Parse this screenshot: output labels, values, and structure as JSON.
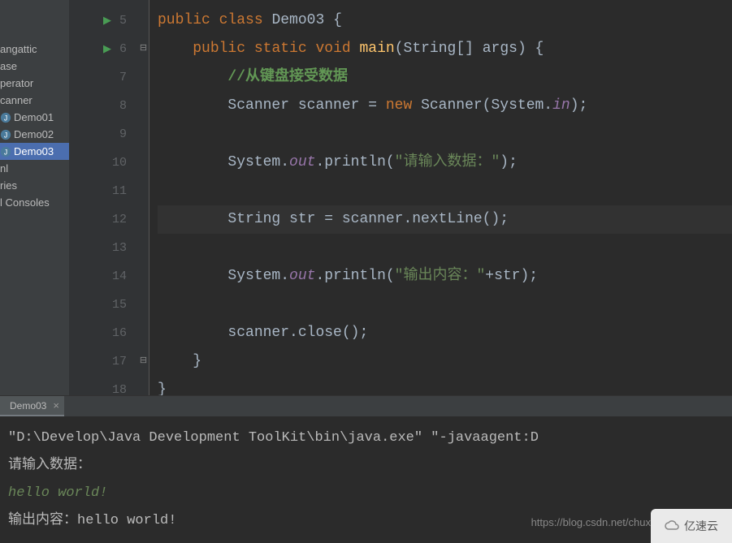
{
  "sidebar": {
    "items": [
      {
        "label": "angattic"
      },
      {
        "label": "ase"
      },
      {
        "label": "perator"
      },
      {
        "label": "canner"
      },
      {
        "label": "Demo01",
        "icon": true
      },
      {
        "label": "Demo02",
        "icon": true
      },
      {
        "label": "Demo03",
        "icon": true,
        "selected": true
      },
      {
        "label": "nl"
      },
      {
        "label": "ries"
      },
      {
        "label": "l Consoles"
      }
    ]
  },
  "editor": {
    "line_start": 5,
    "line_end": 18,
    "highlighted_line": 12,
    "code": {
      "l5": {
        "kw1": "public",
        "kw2": "class",
        "name": "Demo03",
        "brace": "{"
      },
      "l6": {
        "kw1": "public",
        "kw2": "static",
        "kw3": "void",
        "fn": "main",
        "params": "(String[] args) {"
      },
      "l7": {
        "cmt": "//从键盘接受数据"
      },
      "l8": {
        "t1": "Scanner scanner = ",
        "kw": "new",
        "t2": " Scanner(System.",
        "sf": "in",
        "t3": ");"
      },
      "l10": {
        "t1": "System.",
        "sf": "out",
        "t2": ".println(",
        "str": "\"请输入数据：\"",
        "t3": ");"
      },
      "l12": {
        "t": "String str = scanner.nextLine();"
      },
      "l14": {
        "t1": "System.",
        "sf": "out",
        "t2": ".println(",
        "str": "\"输出内容：\"",
        "t3": "+str);"
      },
      "l16": {
        "t": "scanner.close();"
      },
      "l17": {
        "t": "}"
      },
      "l18": {
        "t": "}"
      }
    }
  },
  "console": {
    "tab": "Demo03",
    "lines": {
      "cmd": "\"D:\\Develop\\Java Development ToolKit\\bin\\java.exe\" \"-javaagent:D",
      "prompt": "请输入数据：",
      "input": "hello world!",
      "output_prefix": "输出内容：",
      "output_value": "hello world!"
    }
  },
  "watermark": "https://blog.csdn.net/chux",
  "logo": "亿速云"
}
